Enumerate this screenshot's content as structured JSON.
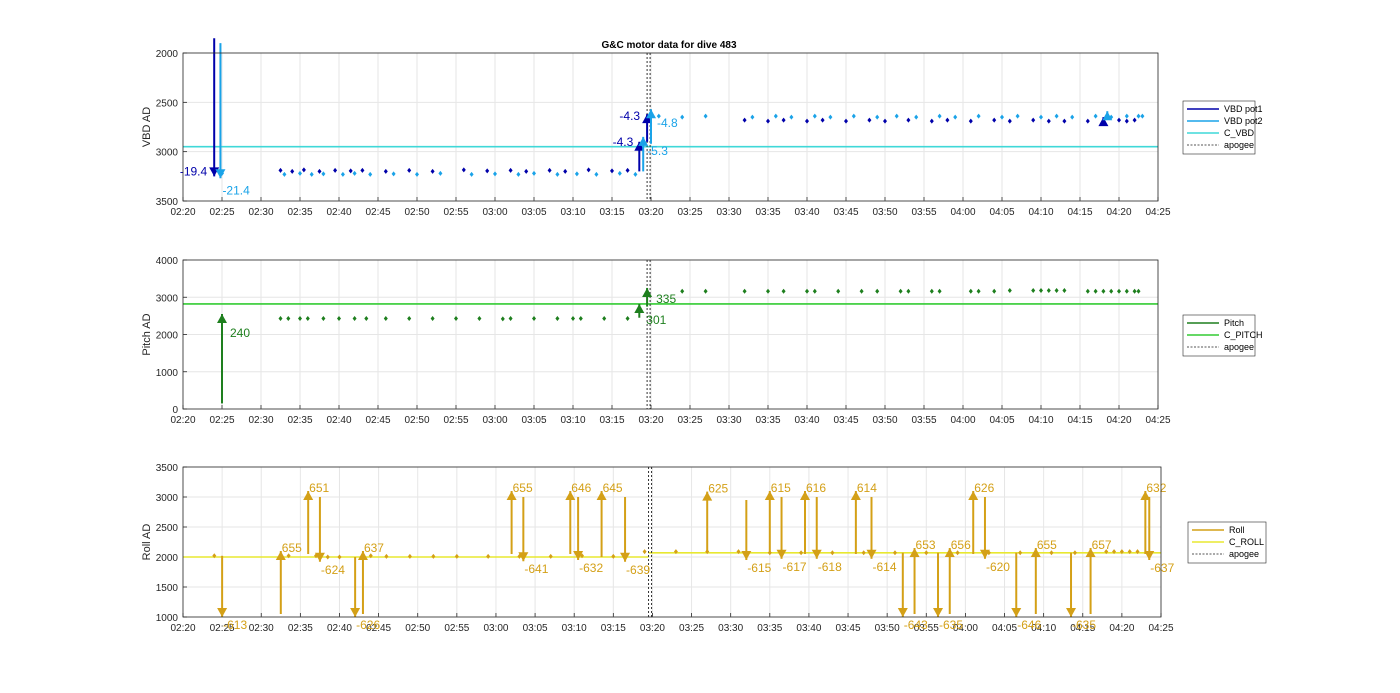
{
  "title": "G&C motor data for dive 483",
  "time_ticks": [
    "02:20",
    "02:25",
    "02:30",
    "02:35",
    "02:40",
    "02:45",
    "02:50",
    "02:55",
    "03:00",
    "03:05",
    "03:10",
    "03:15",
    "03:20",
    "03:25",
    "03:30",
    "03:35",
    "03:40",
    "03:45",
    "03:50",
    "03:55",
    "04:00",
    "04:05",
    "04:10",
    "04:15",
    "04:20",
    "04:25"
  ],
  "apogee_time": "03:19.5",
  "chart_data": [
    {
      "type": "line",
      "ylabel": "VBD AD",
      "ylim": [
        3500,
        2000
      ],
      "yreversed": true,
      "yticks": [
        "2000",
        "2500",
        "3000",
        "3500"
      ],
      "grid": true,
      "legend_position": "right",
      "colors": {
        "pot1": "#0000AA",
        "pot2": "#1AA3E8",
        "cmd": "#3FD8D8",
        "apogee": "#555555"
      },
      "legend": [
        "VBD pot1",
        "VBD pot2",
        "C_VBD",
        "apogee"
      ],
      "c_vbd": 2950,
      "series": [
        {
          "name": "VBD pot1",
          "times": [
            "02:32.5",
            "02:34",
            "02:35.5",
            "02:37.5",
            "02:39.5",
            "02:41.5",
            "02:43",
            "02:46",
            "02:49",
            "02:52",
            "02:56",
            "02:59",
            "03:02",
            "03:04",
            "03:07",
            "03:09",
            "03:12",
            "03:15",
            "03:17",
            "03:32",
            "03:35",
            "03:37",
            "03:40",
            "03:42",
            "03:45",
            "03:48",
            "03:50",
            "03:53",
            "03:56",
            "03:58",
            "04:01",
            "04:04",
            "04:06",
            "04:09",
            "04:11",
            "04:13",
            "04:16",
            "04:18",
            "04:20",
            "04:21",
            "04:22"
          ],
          "values": [
            3190,
            3200,
            3185,
            3200,
            3190,
            3195,
            3190,
            3200,
            3190,
            3200,
            3185,
            3195,
            3190,
            3200,
            3190,
            3200,
            3185,
            3195,
            3190,
            2680,
            2690,
            2680,
            2690,
            2680,
            2690,
            2680,
            2690,
            2680,
            2690,
            2680,
            2690,
            2680,
            2690,
            2680,
            2690,
            2690,
            2690,
            2690,
            2680,
            2690,
            2680
          ]
        },
        {
          "name": "VBD pot2",
          "times": [
            "02:25",
            "02:33",
            "02:35",
            "02:36.5",
            "02:38",
            "02:40.5",
            "02:42",
            "02:44",
            "02:47",
            "02:50",
            "02:53",
            "02:57",
            "03:00",
            "03:03",
            "03:05",
            "03:08",
            "03:10.5",
            "03:13",
            "03:16",
            "03:18",
            "03:21",
            "03:24",
            "03:27",
            "03:33",
            "03:36",
            "03:38",
            "03:41",
            "03:43",
            "03:46",
            "03:49",
            "03:51.5",
            "03:54",
            "03:57",
            "03:59",
            "04:02",
            "04:05",
            "04:07",
            "04:10",
            "04:12",
            "04:14",
            "04:17",
            "04:19",
            "04:21",
            "04:22.5",
            "04:23"
          ],
          "values": [
            3220,
            3230,
            3220,
            3230,
            3225,
            3230,
            3220,
            3230,
            3225,
            3230,
            3220,
            3230,
            3225,
            3230,
            3220,
            3230,
            3225,
            3230,
            3220,
            3230,
            2640,
            2650,
            2640,
            2650,
            2640,
            2650,
            2640,
            2650,
            2640,
            2650,
            2640,
            2650,
            2640,
            2650,
            2640,
            2650,
            2640,
            2650,
            2640,
            2650,
            2640,
            2650,
            2640,
            2640,
            2640
          ]
        }
      ],
      "arrows": [
        {
          "series": "VBD pot1",
          "t0": "02:24",
          "t1": "02:24",
          "v0": 1850,
          "v1": 3250,
          "label": "-19.4"
        },
        {
          "series": "VBD pot2",
          "t0": "02:24.8",
          "t1": "02:24.8",
          "v0": 1900,
          "v1": 3270,
          "label": "-21.4"
        },
        {
          "series": "VBD pot1",
          "t0": "03:18.5",
          "t1": "03:18.5",
          "v0": 3200,
          "v1": 2900,
          "label": "-4.3"
        },
        {
          "series": "VBD pot1",
          "t0": "03:19.5",
          "t1": "03:19.5",
          "v0": 2900,
          "v1": 2620,
          "label": "-4.3"
        },
        {
          "series": "VBD pot2",
          "t0": "03:19",
          "t1": "03:19",
          "v0": 3200,
          "v1": 2850,
          "label": "-5.3"
        },
        {
          "series": "VBD pot2",
          "t0": "03:20",
          "t1": "03:20",
          "v0": 2920,
          "v1": 2570,
          "label": "-4.8"
        },
        {
          "series": "VBD pot1",
          "t0": "04:18",
          "t1": "04:18",
          "v0": 2700,
          "v1": 2650,
          "label": ""
        },
        {
          "series": "VBD pot2",
          "t0": "04:18.5",
          "t1": "04:18.5",
          "v0": 2660,
          "v1": 2590,
          "label": ""
        }
      ]
    },
    {
      "type": "line",
      "ylabel": "Pitch AD",
      "ylim": [
        0,
        4000
      ],
      "yticks": [
        "0",
        "1000",
        "2000",
        "3000",
        "4000"
      ],
      "grid": true,
      "legend_position": "right",
      "colors": {
        "pitch": "#1E7F1E",
        "cmd": "#33CC33",
        "apogee": "#555555"
      },
      "legend": [
        "Pitch",
        "C_PITCH",
        "apogee"
      ],
      "c_pitch": 2820,
      "series": [
        {
          "name": "Pitch",
          "times": [
            "02:32.5",
            "02:33.5",
            "02:35",
            "02:36",
            "02:38",
            "02:40",
            "02:42",
            "02:43.5",
            "02:46",
            "02:49",
            "02:52",
            "02:55",
            "02:58",
            "03:01",
            "03:02",
            "03:05",
            "03:08",
            "03:10",
            "03:11",
            "03:14",
            "03:17",
            "03:24",
            "03:27",
            "03:32",
            "03:35",
            "03:37",
            "03:40",
            "03:41",
            "03:44",
            "03:47",
            "03:49",
            "03:52",
            "03:53",
            "03:56",
            "03:57",
            "04:01",
            "04:02",
            "04:04",
            "04:06",
            "04:09",
            "04:10",
            "04:11",
            "04:12",
            "04:13",
            "04:16",
            "04:17",
            "04:18",
            "04:19",
            "04:20",
            "04:21",
            "04:22",
            "04:22.5"
          ],
          "values": [
            2430,
            2430,
            2430,
            2430,
            2430,
            2430,
            2430,
            2430,
            2430,
            2430,
            2430,
            2430,
            2430,
            2420,
            2430,
            2430,
            2430,
            2430,
            2430,
            2430,
            2430,
            3160,
            3160,
            3160,
            3160,
            3160,
            3160,
            3160,
            3160,
            3160,
            3160,
            3160,
            3160,
            3160,
            3160,
            3160,
            3160,
            3160,
            3180,
            3180,
            3180,
            3180,
            3180,
            3180,
            3160,
            3160,
            3160,
            3160,
            3160,
            3160,
            3160,
            3160
          ]
        }
      ],
      "arrows": [
        {
          "t0": "02:25",
          "t1": "02:25",
          "v0": 150,
          "v1": 2550,
          "label": "240"
        },
        {
          "t0": "03:18.5",
          "t1": "03:18.5",
          "v0": 2450,
          "v1": 2820,
          "label": "301"
        },
        {
          "t0": "03:19.5",
          "t1": "03:19.5",
          "v0": 2750,
          "v1": 3250,
          "label": "335"
        }
      ]
    },
    {
      "type": "line",
      "ylabel": "Roll AD",
      "ylim": [
        1000,
        3500
      ],
      "yticks": [
        "1000",
        "1500",
        "2000",
        "2500",
        "3000",
        "3500"
      ],
      "grid": true,
      "legend_position": "right",
      "colors": {
        "roll": "#D4A017",
        "cmd": "#E8E830",
        "apogee": "#555555"
      },
      "legend": [
        "Roll",
        "C_ROLL",
        "apogee"
      ],
      "c_roll": 2000,
      "c_roll_after": 2070,
      "series": [
        {
          "name": "Roll",
          "times": [
            "02:24",
            "02:33.5",
            "02:37",
            "02:38.5",
            "02:40",
            "02:44",
            "02:46",
            "02:49",
            "02:52",
            "02:55",
            "02:59",
            "03:03",
            "03:07",
            "03:11",
            "03:15",
            "03:19",
            "03:23",
            "03:27",
            "03:31",
            "03:35",
            "03:39",
            "03:43",
            "03:47",
            "03:51",
            "03:55",
            "03:59",
            "04:03",
            "04:07",
            "04:11",
            "04:14",
            "04:18",
            "04:19",
            "04:20",
            "04:21",
            "04:22"
          ],
          "values": [
            2020,
            2020,
            2020,
            2000,
            2000,
            2020,
            2010,
            2010,
            2010,
            2010,
            2010,
            2010,
            2010,
            2020,
            2010,
            2090,
            2090,
            2090,
            2090,
            2070,
            2070,
            2070,
            2070,
            2070,
            2070,
            2070,
            2070,
            2070,
            2070,
            2070,
            2090,
            2090,
            2090,
            2090,
            2090
          ]
        }
      ],
      "arrows": [
        {
          "t0": "02:25",
          "t1": "02:25",
          "v0": 2020,
          "v1": 1000,
          "label": "-613"
        },
        {
          "t0": "02:32.5",
          "t1": "02:32.5",
          "v0": 1050,
          "v1": 2100,
          "label": "655"
        },
        {
          "t0": "02:36",
          "t1": "02:36",
          "v0": 2050,
          "v1": 3100,
          "label": "651"
        },
        {
          "t0": "02:37.5",
          "t1": "02:37.5",
          "v0": 3000,
          "v1": 1920,
          "label": "-624"
        },
        {
          "t0": "02:42",
          "t1": "02:42",
          "v0": 2000,
          "v1": 1000,
          "label": "-626"
        },
        {
          "t0": "02:43",
          "t1": "02:43",
          "v0": 1050,
          "v1": 2100,
          "label": "637"
        },
        {
          "t0": "03:02",
          "t1": "03:02",
          "v0": 2050,
          "v1": 3100,
          "label": "655"
        },
        {
          "t0": "03:03.5",
          "t1": "03:03.5",
          "v0": 3000,
          "v1": 1930,
          "label": "-641"
        },
        {
          "t0": "03:09.5",
          "t1": "03:09.5",
          "v0": 2050,
          "v1": 3100,
          "label": "646"
        },
        {
          "t0": "03:10.5",
          "t1": "03:10.5",
          "v0": 3000,
          "v1": 1950,
          "label": "-632"
        },
        {
          "t0": "03:13.5",
          "t1": "03:13.5",
          "v0": 2000,
          "v1": 3100,
          "label": "645"
        },
        {
          "t0": "03:16.5",
          "t1": "03:16.5",
          "v0": 3000,
          "v1": 1920,
          "label": "-639"
        },
        {
          "t0": "03:27",
          "t1": "03:27",
          "v0": 2090,
          "v1": 3090,
          "label": "625"
        },
        {
          "t0": "03:32",
          "t1": "03:32",
          "v0": 2950,
          "v1": 1950,
          "label": "-615"
        },
        {
          "t0": "03:35",
          "t1": "03:35",
          "v0": 2050,
          "v1": 3100,
          "label": "615"
        },
        {
          "t0": "03:36.5",
          "t1": "03:36.5",
          "v0": 3000,
          "v1": 1970,
          "label": "-617"
        },
        {
          "t0": "03:39.5",
          "t1": "03:39.5",
          "v0": 2050,
          "v1": 3100,
          "label": "616"
        },
        {
          "t0": "03:41",
          "t1": "03:41",
          "v0": 3000,
          "v1": 1970,
          "label": "-618"
        },
        {
          "t0": "03:46",
          "t1": "03:46",
          "v0": 2050,
          "v1": 3100,
          "label": "614"
        },
        {
          "t0": "03:48",
          "t1": "03:48",
          "v0": 3000,
          "v1": 1970,
          "label": "-614"
        },
        {
          "t0": "03:52",
          "t1": "03:52",
          "v0": 2070,
          "v1": 1000,
          "label": "-643"
        },
        {
          "t0": "03:53.5",
          "t1": "03:53.5",
          "v0": 1050,
          "v1": 2150,
          "label": "653"
        },
        {
          "t0": "03:56.5",
          "t1": "03:56.5",
          "v0": 2070,
          "v1": 1000,
          "label": "-635"
        },
        {
          "t0": "03:58",
          "t1": "03:58",
          "v0": 1050,
          "v1": 2150,
          "label": "656"
        },
        {
          "t0": "04:01",
          "t1": "04:01",
          "v0": 2050,
          "v1": 3100,
          "label": "626"
        },
        {
          "t0": "04:02.5",
          "t1": "04:02.5",
          "v0": 3000,
          "v1": 1970,
          "label": "-620"
        },
        {
          "t0": "04:06.5",
          "t1": "04:06.5",
          "v0": 2070,
          "v1": 1000,
          "label": "-646"
        },
        {
          "t0": "04:09",
          "t1": "04:09",
          "v0": 1050,
          "v1": 2150,
          "label": "655"
        },
        {
          "t0": "04:13.5",
          "t1": "04:13.5",
          "v0": 2070,
          "v1": 1000,
          "label": "-635"
        },
        {
          "t0": "04:16",
          "t1": "04:16",
          "v0": 1050,
          "v1": 2150,
          "label": "657"
        },
        {
          "t0": "04:23",
          "t1": "04:23",
          "v0": 2050,
          "v1": 3100,
          "label": "632"
        },
        {
          "t0": "04:23.5",
          "t1": "04:23.5",
          "v0": 3000,
          "v1": 1950,
          "label": "-637"
        }
      ]
    }
  ]
}
